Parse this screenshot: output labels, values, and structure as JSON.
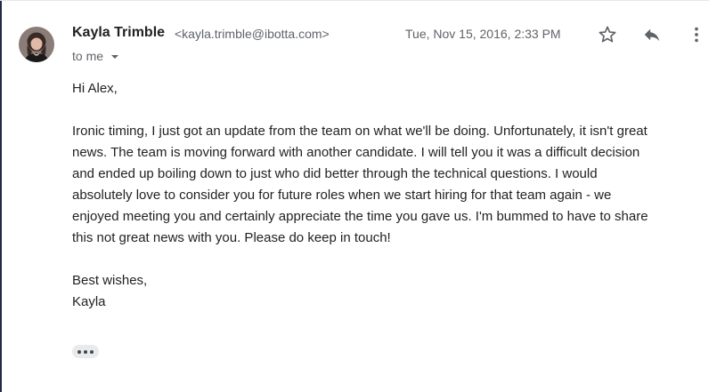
{
  "message": {
    "sender_name": "Kayla Trimble",
    "sender_email": "<kayla.trimble@ibotta.com>",
    "date": "Tue, Nov 15, 2016, 2:33 PM",
    "recipient": "to me",
    "greeting": "Hi Alex,",
    "body_lines": [
      "Ironic timing, I just got an update from the team on what we'll be doing. Unfortunately, it isn't great",
      "news. The team is moving forward with another candidate. I will tell you it was a difficult decision",
      "and ended up boiling down to just who did better through the technical questions. I would",
      "absolutely love to consider you for future roles when we start hiring for that team again - we",
      "enjoyed meeting you and certainly appreciate the time you gave us. I'm bummed to have to share",
      "this not great news with you. Please do keep in touch!"
    ],
    "closing": "Best wishes,",
    "signature": "Kayla"
  },
  "icons": {
    "star": "star-outline-icon",
    "reply": "reply-arrow-icon",
    "more": "more-vertical-icon",
    "trimmed": "ellipsis-icon"
  },
  "colors": {
    "sender_name": "#202124",
    "secondary_text": "#5f6368",
    "body_text": "#222222",
    "trimmed_bg": "#e8eaed"
  }
}
